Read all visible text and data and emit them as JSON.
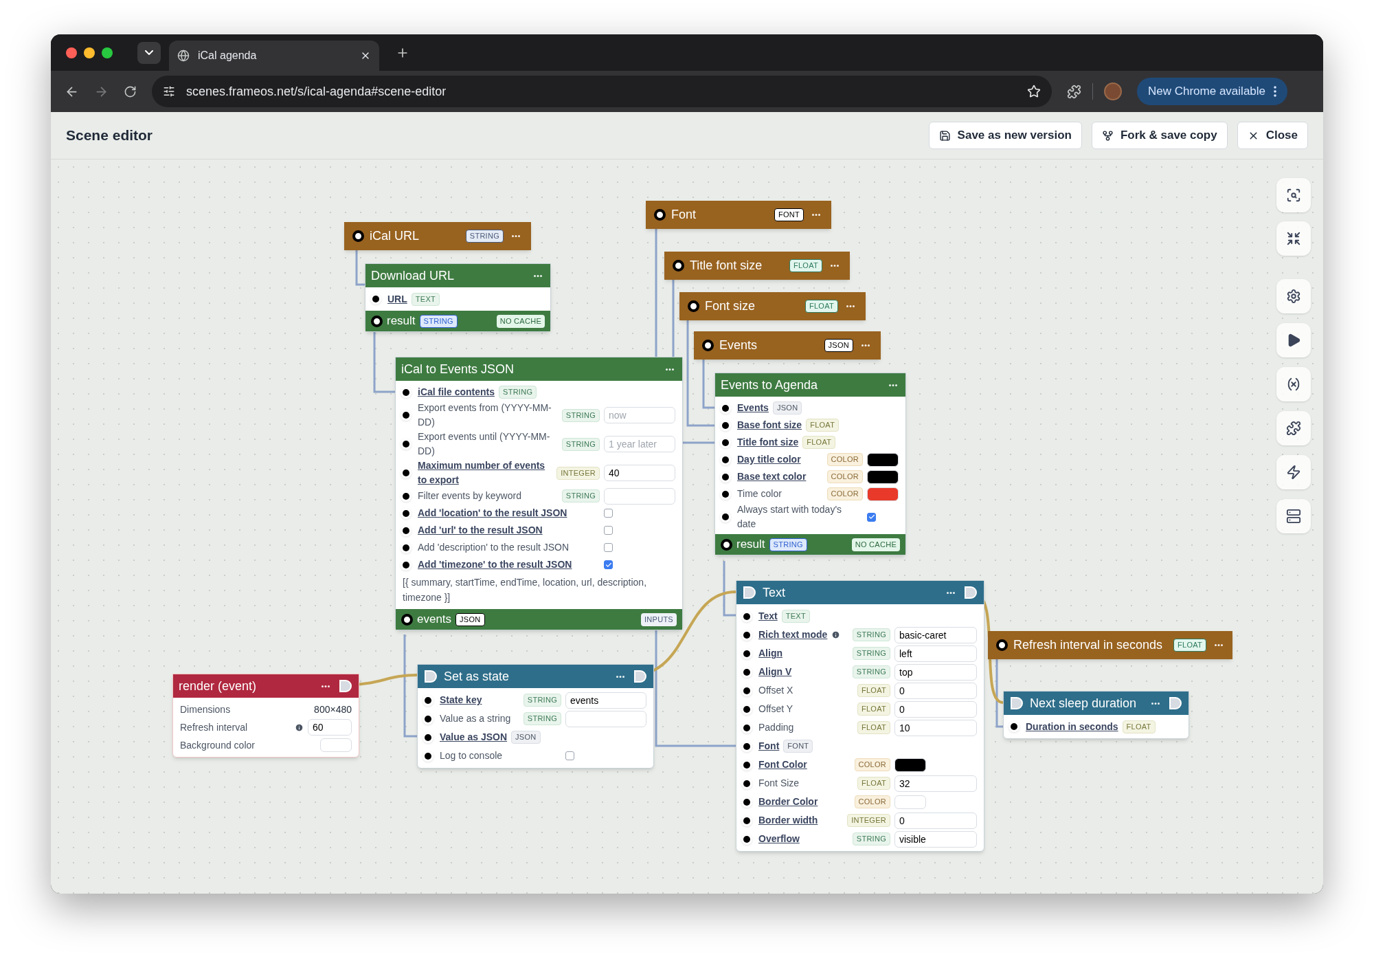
{
  "browser": {
    "tab": {
      "title": "iCal agenda"
    },
    "url": "scenes.frameos.net/s/ical-agenda#scene-editor",
    "update_button": "New Chrome available"
  },
  "editor": {
    "title": "Scene editor",
    "actions": [
      {
        "label": "Save as new version",
        "kind": "save"
      },
      {
        "label": "Fork & save copy",
        "kind": "fork"
      },
      {
        "label": "Close",
        "kind": "close"
      }
    ]
  },
  "nodes": [
    {
      "kind": "value",
      "title": "iCal URL",
      "tag": {
        "text": "STRING",
        "kind": "string"
      }
    },
    {
      "kind": "app",
      "title": "Download URL",
      "fields": [
        {
          "kind": "none",
          "label": "URL",
          "linked": true,
          "tag": {
            "text": "TEXT",
            "kind": "text"
          }
        }
      ],
      "output": {
        "label": "result",
        "tag": {
          "text": "STRING",
          "kind": "string"
        },
        "badge": {
          "text": "NO CACHE",
          "kind": "cache"
        }
      }
    },
    {
      "kind": "app",
      "title": "iCal to Events JSON",
      "fields": [
        {
          "kind": "none",
          "label": "iCal file contents",
          "linked": true,
          "tag": {
            "text": "STRING",
            "kind": "string"
          }
        },
        {
          "kind": "input",
          "label": "Export events from (YYYY-MM-DD)",
          "linked": false,
          "tag": {
            "text": "STRING",
            "kind": "string"
          },
          "placeholder": "now"
        },
        {
          "kind": "input",
          "label": "Export events until (YYYY-MM-DD)",
          "linked": false,
          "tag": {
            "text": "STRING",
            "kind": "string"
          },
          "placeholder": "1 year later"
        },
        {
          "kind": "input",
          "label": "Maximum number of events to export",
          "linked": true,
          "tag": {
            "text": "INTEGER",
            "kind": "integer"
          },
          "value": "40"
        },
        {
          "kind": "input",
          "label": "Filter events by keyword",
          "linked": false,
          "tag": {
            "text": "STRING",
            "kind": "string"
          }
        },
        {
          "kind": "checkbox",
          "label": "Add 'location' to the result JSON",
          "linked": true,
          "checked": false
        },
        {
          "kind": "checkbox",
          "label": "Add 'url' to the result JSON",
          "linked": true,
          "checked": false
        },
        {
          "kind": "checkbox",
          "label": "Add 'description' to the result JSON",
          "linked": false,
          "checked": false
        },
        {
          "kind": "checkbox",
          "label": "Add 'timezone' to the result JSON",
          "linked": true,
          "checked": true
        },
        {
          "kind": "note",
          "label": "[{ summary, startTime, endTime, location, url, description, timezone }]"
        }
      ],
      "output": {
        "label": "events",
        "tag": {
          "text": "JSON",
          "kind": "json"
        },
        "badge": {
          "text": "INPUTS",
          "kind": "inputs"
        }
      }
    },
    {
      "kind": "value",
      "title": "Font",
      "tag": {
        "text": "FONT",
        "kind": "font"
      }
    },
    {
      "kind": "value",
      "title": "Title font size",
      "tag": {
        "text": "FLOAT",
        "kind": "float"
      }
    },
    {
      "kind": "value",
      "title": "Font size",
      "tag": {
        "text": "FLOAT",
        "kind": "float"
      }
    },
    {
      "kind": "value",
      "title": "Events",
      "tag": {
        "text": "JSON",
        "kind": "json"
      }
    },
    {
      "kind": "app",
      "title": "Events to Agenda",
      "fields": [
        {
          "kind": "none",
          "label": "Events",
          "linked": true,
          "tag": {
            "text": "JSON",
            "kind": "json"
          }
        },
        {
          "kind": "none",
          "label": "Base font size",
          "linked": true,
          "tag": {
            "text": "FLOAT",
            "kind": "float"
          }
        },
        {
          "kind": "none",
          "label": "Title font size",
          "linked": true,
          "tag": {
            "text": "FLOAT",
            "kind": "float"
          }
        },
        {
          "kind": "color",
          "label": "Day title color",
          "linked": true,
          "tag": {
            "text": "COLOR",
            "kind": "color"
          },
          "color": "#000000"
        },
        {
          "kind": "color",
          "label": "Base text color",
          "linked": true,
          "tag": {
            "text": "COLOR",
            "kind": "color"
          },
          "color": "#000000"
        },
        {
          "kind": "color",
          "label": "Time color",
          "linked": false,
          "tag": {
            "text": "COLOR",
            "kind": "color"
          },
          "color": "#e8392a"
        },
        {
          "kind": "checkbox",
          "label": "Always start with today's date",
          "linked": false,
          "checked": true
        }
      ],
      "output": {
        "label": "result",
        "tag": {
          "text": "STRING",
          "kind": "string"
        },
        "badge": {
          "text": "NO CACHE",
          "kind": "cache"
        }
      }
    },
    {
      "kind": "event",
      "title": "render (event)",
      "fields": [
        {
          "kind": "text",
          "label": "Dimensions",
          "value": "800×480"
        },
        {
          "kind": "input",
          "label": "Refresh interval",
          "info": true,
          "value": "60"
        },
        {
          "kind": "color",
          "label": "Background color",
          "color": "#ffffff"
        }
      ]
    },
    {
      "kind": "action",
      "title": "Set as state",
      "fields": [
        {
          "kind": "input",
          "label": "State key",
          "linked": true,
          "tag": {
            "text": "STRING",
            "kind": "string"
          },
          "value": "events"
        },
        {
          "kind": "input",
          "label": "Value as a string",
          "linked": false,
          "tag": {
            "text": "STRING",
            "kind": "string"
          }
        },
        {
          "kind": "none",
          "label": "Value as JSON",
          "linked": true,
          "tag": {
            "text": "JSON",
            "kind": "json"
          }
        },
        {
          "kind": "checkbox",
          "label": "Log to console",
          "linked": false,
          "checked": false
        }
      ]
    },
    {
      "kind": "action",
      "title": "Text",
      "fields": [
        {
          "kind": "none",
          "label": "Text",
          "linked": true,
          "tag": {
            "text": "TEXT",
            "kind": "text"
          }
        },
        {
          "kind": "input",
          "label": "Rich text mode",
          "linked": true,
          "info": true,
          "tag": {
            "text": "STRING",
            "kind": "string"
          },
          "value": "basic-caret"
        },
        {
          "kind": "input",
          "label": "Align",
          "linked": true,
          "tag": {
            "text": "STRING",
            "kind": "string"
          },
          "value": "left"
        },
        {
          "kind": "input",
          "label": "Align V",
          "linked": true,
          "tag": {
            "text": "STRING",
            "kind": "string"
          },
          "value": "top"
        },
        {
          "kind": "input",
          "label": "Offset X",
          "linked": false,
          "tag": {
            "text": "FLOAT",
            "kind": "float"
          },
          "value": "0"
        },
        {
          "kind": "input",
          "label": "Offset Y",
          "linked": false,
          "tag": {
            "text": "FLOAT",
            "kind": "float"
          },
          "value": "0"
        },
        {
          "kind": "input",
          "label": "Padding",
          "linked": false,
          "tag": {
            "text": "FLOAT",
            "kind": "float"
          },
          "value": "10"
        },
        {
          "kind": "none",
          "label": "Font",
          "linked": true,
          "tag": {
            "text": "FONT",
            "kind": "font"
          }
        },
        {
          "kind": "color",
          "label": "Font Color",
          "linked": true,
          "tag": {
            "text": "COLOR",
            "kind": "color"
          },
          "color": "#000000"
        },
        {
          "kind": "input",
          "label": "Font Size",
          "linked": false,
          "tag": {
            "text": "FLOAT",
            "kind": "float"
          },
          "value": "32"
        },
        {
          "kind": "color",
          "label": "Border Color",
          "linked": true,
          "tag": {
            "text": "COLOR",
            "kind": "color"
          },
          "color": "#ffffff"
        },
        {
          "kind": "input",
          "label": "Border width",
          "linked": true,
          "tag": {
            "text": "INTEGER",
            "kind": "integer"
          },
          "value": "0"
        },
        {
          "kind": "input",
          "label": "Overflow",
          "linked": true,
          "tag": {
            "text": "STRING",
            "kind": "string"
          },
          "value": "visible"
        }
      ]
    },
    {
      "kind": "value",
      "title": "Refresh interval in seconds",
      "tag": {
        "text": "FLOAT",
        "kind": "float"
      }
    },
    {
      "kind": "action",
      "title": "Next sleep duration",
      "fields": [
        {
          "kind": "none",
          "label": "Duration in seconds",
          "linked": true,
          "tag": {
            "text": "FLOAT",
            "kind": "float"
          }
        }
      ]
    }
  ]
}
